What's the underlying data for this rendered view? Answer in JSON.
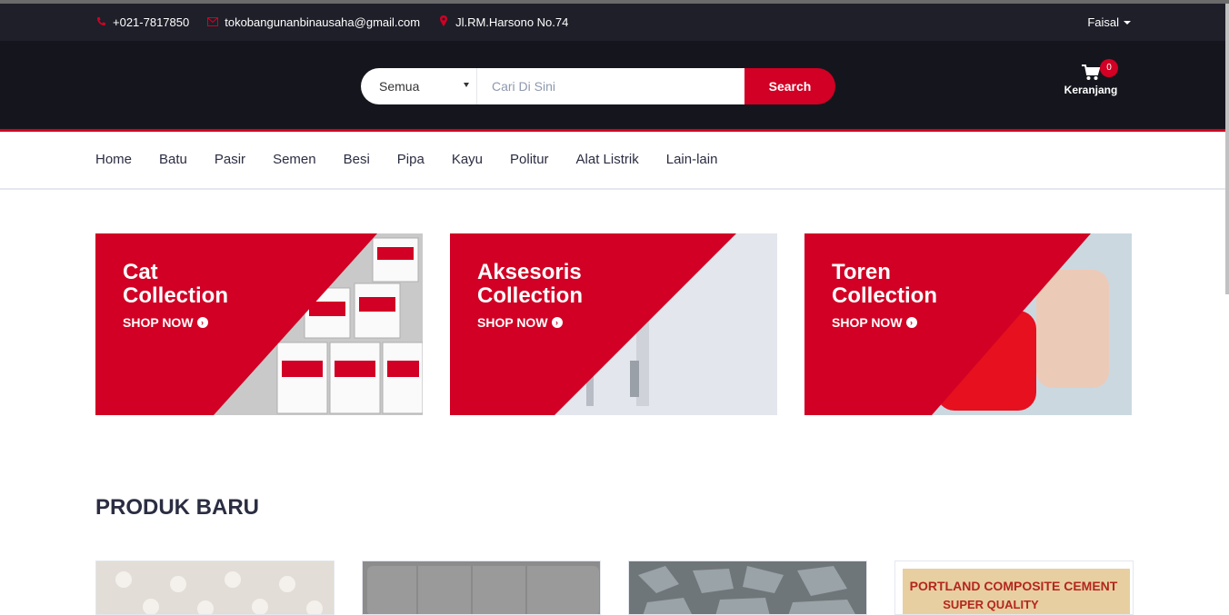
{
  "topbar": {
    "phone": "+021-7817850",
    "email": "tokobangunanbinausaha@gmail.com",
    "address": "Jl.RM.Harsono No.74",
    "user": "Faisal"
  },
  "search": {
    "category": "Semua",
    "placeholder": "Cari Di Sini",
    "button": "Search"
  },
  "cart": {
    "count": "0",
    "label": "Keranjang"
  },
  "nav": [
    "Home",
    "Batu",
    "Pasir",
    "Semen",
    "Besi",
    "Pipa",
    "Kayu",
    "Politur",
    "Alat Listrik",
    "Lain-lain"
  ],
  "collections": [
    {
      "line1": "Cat",
      "line2": "Collection",
      "cta": "SHOP NOW"
    },
    {
      "line1": "Aksesoris",
      "line2": "Collection",
      "cta": "SHOP NOW"
    },
    {
      "line1": "Toren",
      "line2": "Collection",
      "cta": "SHOP NOW"
    }
  ],
  "section": {
    "title": "PRODUK BARU"
  },
  "products": [
    {
      "image": "lace-pattern"
    },
    {
      "image": "gray-headboard"
    },
    {
      "image": "stones"
    },
    {
      "image_text": "PORTLAND COMPOSITE CEMENT",
      "image_text2": "SUPER QUALITY"
    }
  ],
  "colors": {
    "accent": "#d10024",
    "dark": "#15161d",
    "topbar": "#1e1f29",
    "text": "#2b2d42"
  }
}
